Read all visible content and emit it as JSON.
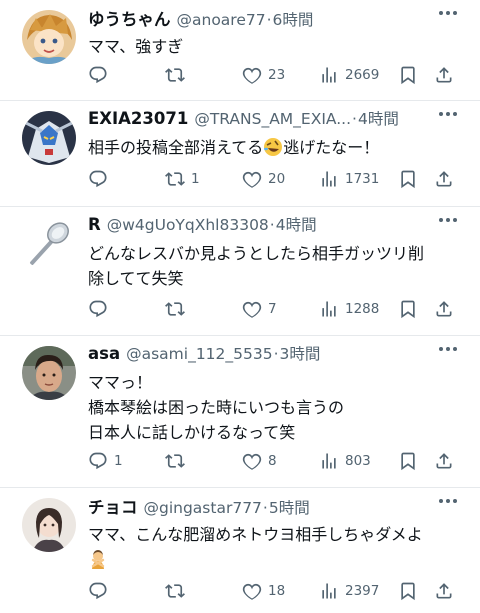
{
  "posts": [
    {
      "name": "ゆうちゃん",
      "handle": "@anoare77",
      "time": "6時間",
      "lines": [
        "ママ、強すぎ"
      ],
      "replies": "",
      "reposts": "",
      "likes": "23",
      "views": "2669"
    },
    {
      "name": "EXIA23071",
      "handle": "@TRANS_AM_EXIA...",
      "time": "4時間",
      "line_before_emoji": "相手の投稿全部消えてる",
      "line_after_emoji": "逃げたなー！",
      "replies": "",
      "reposts": "1",
      "likes": "20",
      "views": "1731"
    },
    {
      "name": "R",
      "handle": "@w4gUoYqXhl83308",
      "time": "4時間",
      "lines": [
        "どんなレスバか見ようとしたら相手ガッツリ削",
        "除してて失笑"
      ],
      "replies": "",
      "reposts": "",
      "likes": "7",
      "views": "1288"
    },
    {
      "name": "asa",
      "handle": "@asami_112_5535",
      "time": "3時間",
      "lines": [
        "ママっ！",
        "橋本琴絵は困った時にいつも言うの",
        "日本人に話しかけるなって笑"
      ],
      "replies": "1",
      "reposts": "",
      "likes": "8",
      "views": "803"
    },
    {
      "name": "チョコ",
      "handle": "@gingastar777",
      "time": "5時間",
      "lines": [
        "ママ、こんな肥溜めネトウヨ相手しちゃダメよ"
      ],
      "replies": "",
      "reposts": "",
      "likes": "18",
      "views": "2397"
    }
  ],
  "separator": "·",
  "icons": {
    "reply": "reply-icon",
    "repost": "repost-icon",
    "like": "heart-icon",
    "views": "views-icon",
    "bookmark": "bookmark-icon",
    "share": "share-icon",
    "more": "more-icon"
  }
}
